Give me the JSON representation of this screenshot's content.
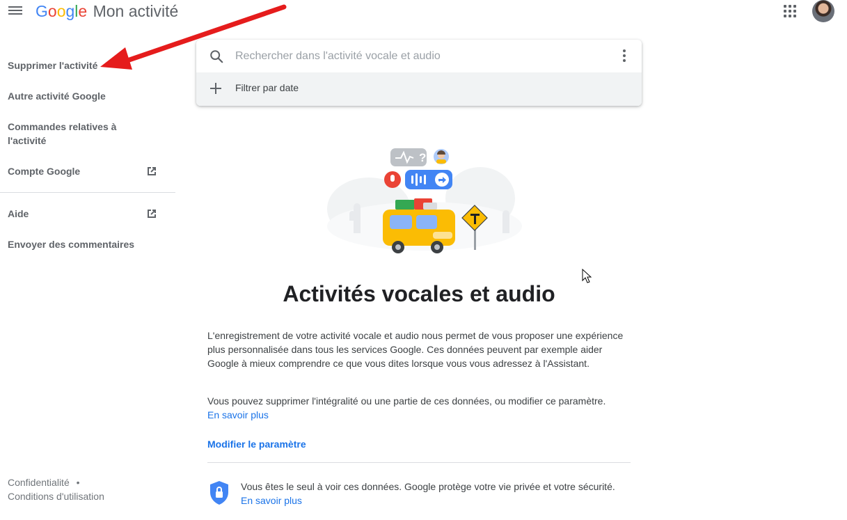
{
  "header": {
    "brand_letters": [
      "G",
      "o",
      "o",
      "g",
      "l",
      "e"
    ],
    "product": "Mon activité",
    "menu_icon": "hamburger-menu-icon",
    "apps_icon": "apps-grid-icon",
    "avatar": "account-avatar"
  },
  "sidebar": {
    "items": [
      {
        "label": "Supprimer l'activité"
      },
      {
        "label": "Autre activité Google"
      },
      {
        "label": "Commandes relatives à l'activité"
      },
      {
        "label": "Compte Google",
        "icon": "open-in-new-icon"
      },
      {
        "label": "Aide",
        "icon": "open-in-new-icon"
      },
      {
        "label": "Envoyer des commentaires"
      }
    ],
    "footer": {
      "privacy": "Confidentialité",
      "separator": "•",
      "terms": "Conditions d'utilisation"
    }
  },
  "search": {
    "placeholder": "Rechercher dans l'activité vocale et audio",
    "filter_label": "Filtrer par date"
  },
  "main": {
    "title": "Activités vocales et audio",
    "description": "L'enregistrement de votre activité vocale et audio nous permet de vous proposer une expérience plus personnalisée dans tous les services Google. Ces données peuvent par exemple aider Google à mieux comprendre ce que vous dites lorsque vous vous adressez à l'Assistant.",
    "delete_text": "Vous pouvez supprimer l'intégralité ou une partie de ces données, ou modifier ce paramètre.",
    "learn_more": "En savoir plus",
    "modify_setting": "Modifier le paramètre",
    "privacy_text": "Vous êtes le seul à voir ces données. Google protège votre vie privée et votre sécurité.",
    "privacy_learn_more": "En savoir plus"
  },
  "colors": {
    "annotation_arrow": "#e51c1c",
    "link": "#1a73e8",
    "shield": "#4285f4"
  }
}
